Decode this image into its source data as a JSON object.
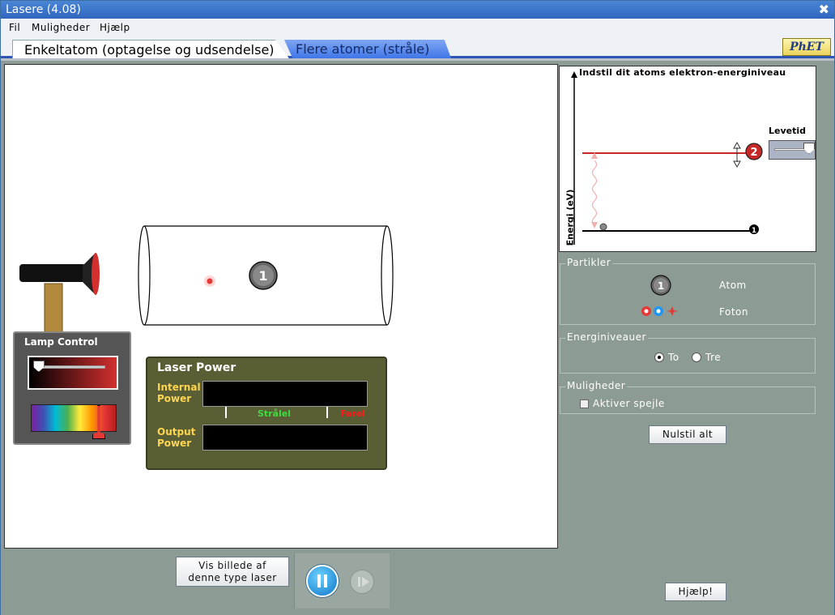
{
  "window": {
    "title": "Lasere (4.08)",
    "close": "✖"
  },
  "menu": {
    "items": [
      "Fil",
      "Muligheder",
      "Hjælp"
    ]
  },
  "tabs": [
    {
      "label": "Enkeltatom (optagelse og udsendelse)"
    },
    {
      "label": "Flere atomer (stråle)"
    }
  ],
  "logo": "PhET",
  "atom_number_ground": "1",
  "atom_number_excited": "2",
  "lamp": {
    "title": "Lamp Control",
    "intensity": 0.03
  },
  "laser_power": {
    "title": "Laser Power",
    "internal_label_1": "Internal",
    "internal_label_2": "Power",
    "beam_label": "Strålel",
    "danger_label": "Farel",
    "output_label_1": "Output",
    "output_label_2": "Power"
  },
  "energy_diagram": {
    "title": "Indstil dit atoms elektron-energiniveau",
    "ylabel": "Energi (eV)",
    "lifetime_label": "Levetid"
  },
  "particles": {
    "title": "Partikler",
    "atom_label": "Atom",
    "photon_label": "Foton"
  },
  "energy_levels": {
    "title": "Energiniveauer",
    "options": [
      "To",
      "Tre"
    ],
    "selected": "To"
  },
  "options": {
    "title": "Muligheder",
    "mirrors_label": "Aktiver spejle",
    "mirrors_checked": false
  },
  "buttons": {
    "reset": "Nulstil alt",
    "show_image_1": "Vis billede af",
    "show_image_2": "denne type laser",
    "help": "Hjælp!"
  },
  "colors": {
    "accent_blue": "#2d55b3",
    "laser_red": "#c62828",
    "panel_olive": "#5a5e34"
  }
}
